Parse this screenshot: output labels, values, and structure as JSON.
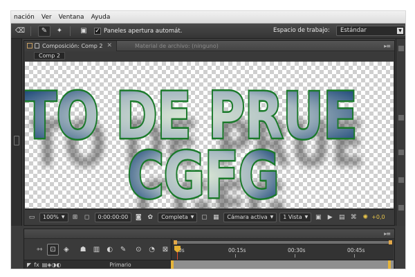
{
  "menubar": {
    "items": [
      "nación",
      "Ver",
      "Ventana",
      "Ayuda"
    ]
  },
  "toolbar": {
    "checkbox_label": "Paneles apertura automát.",
    "checkbox_checked": true,
    "workspace_label": "Espacio de trabajo:",
    "workspace_value": "Estándar"
  },
  "comp_panel": {
    "tabs": [
      {
        "label": "Composición: Comp 2",
        "active": true
      },
      {
        "label": "Material de archivo: (ninguno)",
        "active": false
      }
    ],
    "breadcrumb": "Comp 2",
    "canvas_text": {
      "line1": "TO DE PRUE",
      "line2": "CGFG"
    }
  },
  "viewer_footer": {
    "zoom": "100%",
    "timecode": "0:00:00:00",
    "resolution": "Completa",
    "camera": "Cámara activa",
    "views": "1 Vista",
    "exposure": "+0,0"
  },
  "timeline": {
    "ruler_labels": [
      "0s",
      "00:15s",
      "00:30s",
      "00:45s"
    ],
    "column_label": "Primario"
  },
  "colors": {
    "text_fill": "#1f4a7a",
    "text_outline": "#1a7a2a",
    "accent_orange": "#e5b132",
    "cti_red": "#e84a2b"
  }
}
